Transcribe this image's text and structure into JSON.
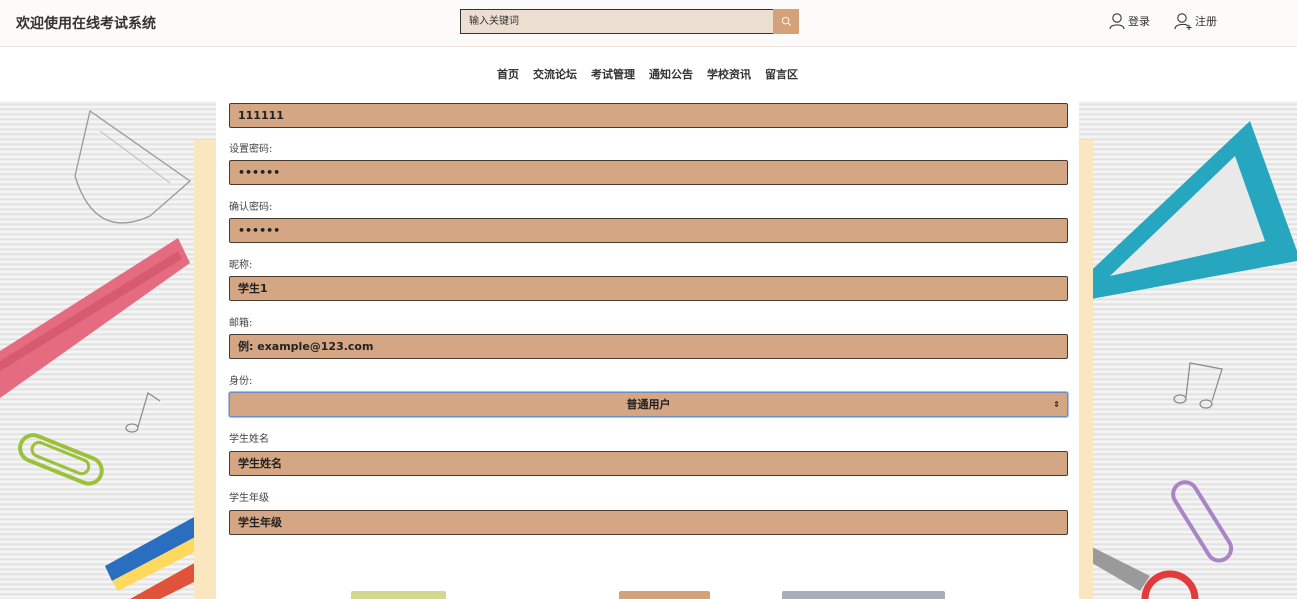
{
  "header": {
    "site_title": "欢迎使用在线考试系统",
    "search_placeholder": "输入关键词",
    "login_label": "登录",
    "register_label": "注册"
  },
  "nav": {
    "items": [
      "首页",
      "交流论坛",
      "考试管理",
      "通知公告",
      "学校资讯",
      "留言区"
    ]
  },
  "form": {
    "account_value": "111111",
    "password_label": "设置密码:",
    "password_value": "••••••",
    "confirm_label": "确认密码:",
    "confirm_value": "••••••",
    "nickname_label": "昵称:",
    "nickname_value": "学生1",
    "email_label": "邮箱:",
    "email_placeholder": "例: example@123.com",
    "role_label": "身份:",
    "role_selected": "普通用户",
    "student_name_label": "学生姓名",
    "student_name_value": "学生姓名",
    "student_grade_label": "学生年级",
    "student_grade_value": "学生年级"
  },
  "colors": {
    "field_bg": "#d4a683",
    "search_btn": "#d4a27a",
    "btn_green": "#d4d88c",
    "btn_brown": "#d4a27a",
    "btn_gray": "#a9adb8"
  },
  "icons": {
    "search": "search-icon",
    "login": "user-icon",
    "register": "add-user-icon"
  }
}
